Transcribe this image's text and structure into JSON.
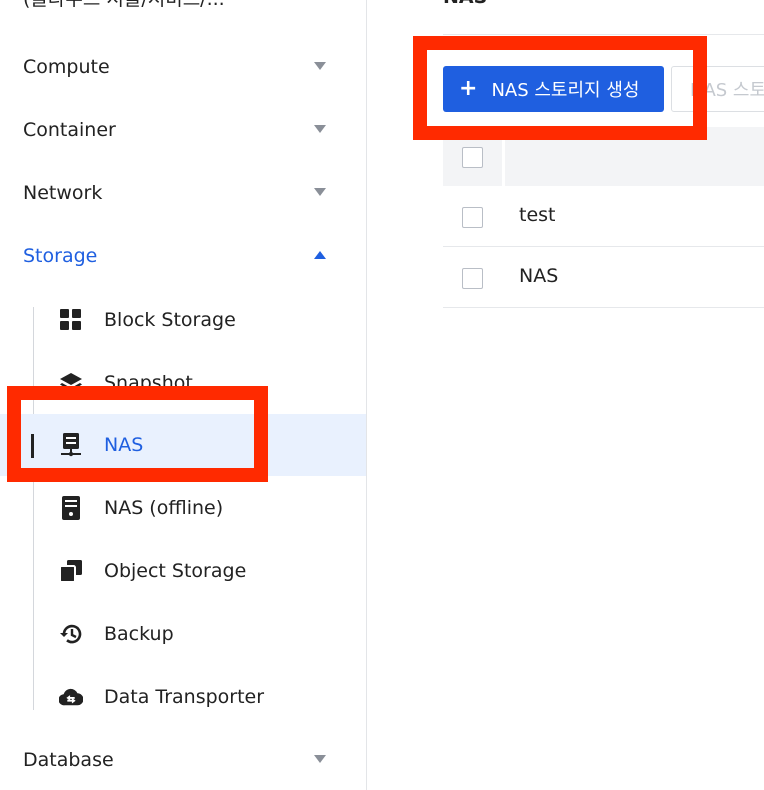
{
  "sidebar": {
    "top_text": "(클라우드 서울/서비스/...",
    "categories": {
      "compute": "Compute",
      "container": "Container",
      "network": "Network",
      "storage": "Storage",
      "database": "Database"
    },
    "storage_items": {
      "block": "Block Storage",
      "snapshot": "Snapshot",
      "nas": "NAS",
      "nas_offline": "NAS (offline)",
      "object": "Object Storage",
      "backup": "Backup",
      "transporter": "Data Transporter"
    },
    "selected_item": "NAS"
  },
  "main": {
    "title": "NAS",
    "create_button": {
      "icon": "plus-icon",
      "label": "NAS 스토리지 생성"
    },
    "secondary_button": "NAS 스토",
    "table": {
      "rows": [
        "test",
        "NAS"
      ]
    }
  },
  "colors": {
    "accent": "#1f5fe0",
    "highlight": "#ff2a00",
    "selected_bg": "#e9f1fe"
  }
}
